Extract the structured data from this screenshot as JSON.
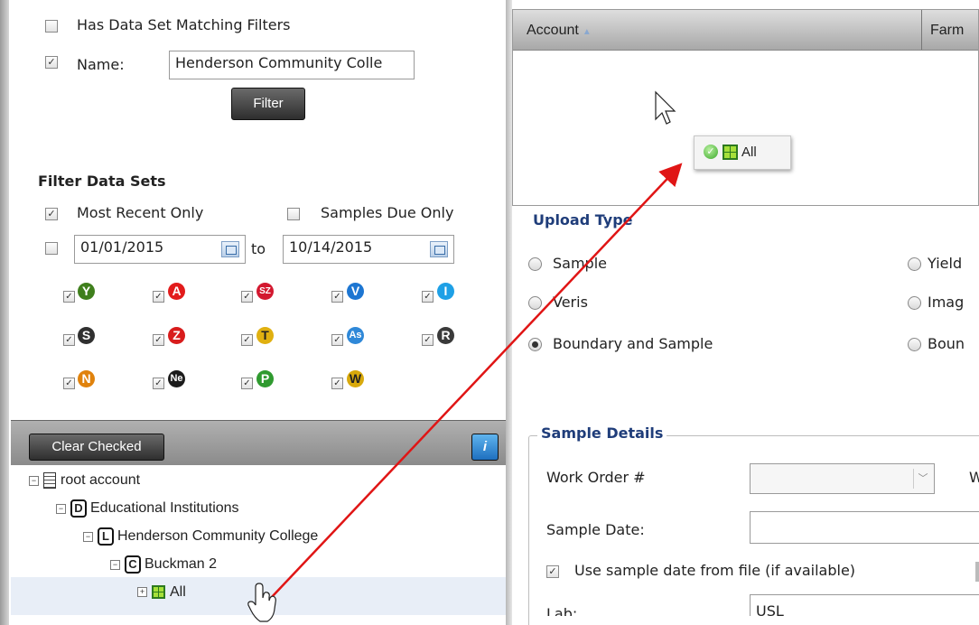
{
  "filters": {
    "has_data_set_label": "Has Data Set Matching Filters",
    "name_label": "Name:",
    "name_value": "Henderson Community Colle",
    "filter_button": "Filter"
  },
  "filter_data_sets": {
    "title": "Filter Data Sets",
    "most_recent_label": "Most Recent Only",
    "samples_due_label": "Samples Due Only",
    "date_from": "01/01/2015",
    "to_label": "to",
    "date_to": "10/14/2015",
    "badges": [
      {
        "letter": "Y",
        "color": "#3f7f1c"
      },
      {
        "letter": "A",
        "color": "#e21b1b"
      },
      {
        "letter": "SZ",
        "color": "#d3182f"
      },
      {
        "letter": "V",
        "color": "#1d76d2"
      },
      {
        "letter": "I",
        "color": "#1ea0e6"
      },
      {
        "letter": "S",
        "color": "#303030"
      },
      {
        "letter": "Z",
        "color": "#d81c1c"
      },
      {
        "letter": "T",
        "color": "#e0b010"
      },
      {
        "letter": "As",
        "color": "#2f88d8"
      },
      {
        "letter": "R",
        "color": "#3a3a3a"
      },
      {
        "letter": "N",
        "color": "#e0820c"
      },
      {
        "letter": "Ne",
        "color": "#1c1c1c"
      },
      {
        "letter": "P",
        "color": "#2f9a2f"
      },
      {
        "letter": "W",
        "color": "#d8a90c"
      }
    ]
  },
  "toolbar": {
    "clear_checked": "Clear Checked",
    "info_glyph": "i"
  },
  "tree": [
    {
      "label": "root account",
      "tag": ""
    },
    {
      "label": "Educational Institutions",
      "tag": "D"
    },
    {
      "label": "Henderson Community College",
      "tag": "L"
    },
    {
      "label": "Buckman 2",
      "tag": "C"
    },
    {
      "label": "All",
      "tag": ""
    }
  ],
  "grid": {
    "col_account": "Account",
    "col_farm": "Farm",
    "drag_label": "All"
  },
  "upload": {
    "title": "Upload Type",
    "options": [
      "Sample",
      "Veris",
      "Boundary and Sample",
      "Yield",
      "Imag",
      "Boun"
    ]
  },
  "sample_details": {
    "legend": "Sample Details",
    "work_order_label": "Work Order #",
    "side_label": "W",
    "sample_date_label": "Sample Date:",
    "use_date_label": "Use sample date from file (if available)",
    "lab_label": "Lab:",
    "lab_value": "USL"
  },
  "colors": {
    "accent_blue": "#1f3d7a",
    "arrow_red": "#e01515"
  }
}
